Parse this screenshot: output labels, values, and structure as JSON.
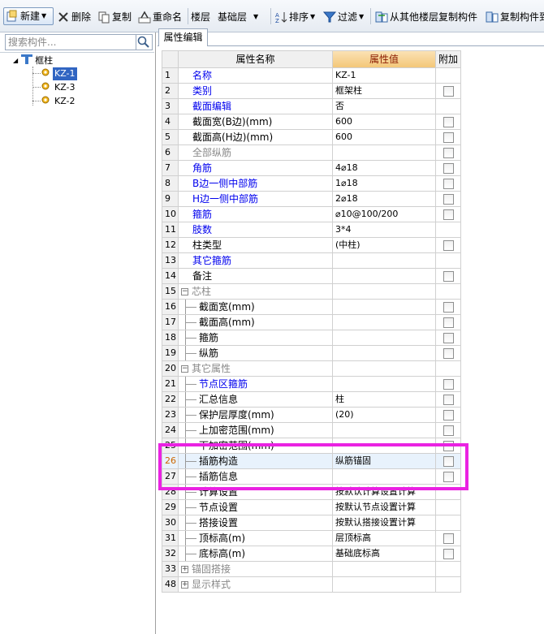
{
  "toolbar": {
    "new_label": "新建",
    "delete_label": "删除",
    "copy_label": "复制",
    "rename_label": "重命名",
    "floor_label": "楼层",
    "floor_value": "基础层",
    "sort_label": "排序",
    "filter_label": "过滤",
    "copy_from_floor_label": "从其他楼层复制构件",
    "copy_component_label": "复制构件到"
  },
  "left": {
    "search_placeholder": "搜索构件...",
    "tree": {
      "root": "框柱",
      "children": [
        "KZ-1",
        "KZ-3",
        "KZ-2"
      ]
    }
  },
  "tab": {
    "label": "属性编辑"
  },
  "table": {
    "headers": {
      "name": "属性名称",
      "value": "属性值",
      "add": "附加"
    },
    "rows": [
      {
        "num": "1",
        "name": "名称",
        "value": "KZ-1",
        "style": "blue",
        "indent": false,
        "check": false,
        "expander": ""
      },
      {
        "num": "2",
        "name": "类别",
        "value": "框架柱",
        "style": "blue",
        "indent": false,
        "check": true,
        "expander": ""
      },
      {
        "num": "3",
        "name": "截面编辑",
        "value": "否",
        "style": "blue",
        "indent": false,
        "check": false,
        "expander": ""
      },
      {
        "num": "4",
        "name": "截面宽(B边)(mm)",
        "value": "600",
        "style": "black",
        "indent": false,
        "check": true,
        "expander": ""
      },
      {
        "num": "5",
        "name": "截面高(H边)(mm)",
        "value": "600",
        "style": "black",
        "indent": false,
        "check": true,
        "expander": ""
      },
      {
        "num": "6",
        "name": "全部纵筋",
        "value": "",
        "style": "gray",
        "indent": false,
        "check": true,
        "expander": ""
      },
      {
        "num": "7",
        "name": "角筋",
        "value": "4⌀18",
        "style": "blue",
        "indent": false,
        "check": true,
        "expander": ""
      },
      {
        "num": "8",
        "name": "B边一侧中部筋",
        "value": "1⌀18",
        "style": "blue",
        "indent": false,
        "check": true,
        "expander": ""
      },
      {
        "num": "9",
        "name": "H边一侧中部筋",
        "value": "2⌀18",
        "style": "blue",
        "indent": false,
        "check": true,
        "expander": ""
      },
      {
        "num": "10",
        "name": "箍筋",
        "value": "⌀10@100/200",
        "style": "blue",
        "indent": false,
        "check": true,
        "expander": ""
      },
      {
        "num": "11",
        "name": "肢数",
        "value": "3*4",
        "style": "blue",
        "indent": false,
        "check": false,
        "expander": ""
      },
      {
        "num": "12",
        "name": "柱类型",
        "value": "(中柱)",
        "style": "black",
        "indent": false,
        "check": true,
        "expander": ""
      },
      {
        "num": "13",
        "name": "其它箍筋",
        "value": "",
        "style": "blue",
        "indent": false,
        "check": false,
        "expander": ""
      },
      {
        "num": "14",
        "name": "备注",
        "value": "",
        "style": "black",
        "indent": false,
        "check": true,
        "expander": ""
      },
      {
        "num": "15",
        "name": "芯柱",
        "value": "",
        "style": "gray",
        "indent": false,
        "check": false,
        "expander": "−"
      },
      {
        "num": "16",
        "name": "截面宽(mm)",
        "value": "",
        "style": "black",
        "indent": true,
        "check": true,
        "expander": ""
      },
      {
        "num": "17",
        "name": "截面高(mm)",
        "value": "",
        "style": "black",
        "indent": true,
        "check": true,
        "expander": ""
      },
      {
        "num": "18",
        "name": "箍筋",
        "value": "",
        "style": "black",
        "indent": true,
        "check": true,
        "expander": ""
      },
      {
        "num": "19",
        "name": "纵筋",
        "value": "",
        "style": "black",
        "indent": true,
        "check": true,
        "expander": ""
      },
      {
        "num": "20",
        "name": "其它属性",
        "value": "",
        "style": "gray",
        "indent": false,
        "check": false,
        "expander": "−"
      },
      {
        "num": "21",
        "name": "节点区箍筋",
        "value": "",
        "style": "blue",
        "indent": true,
        "check": true,
        "expander": ""
      },
      {
        "num": "22",
        "name": "汇总信息",
        "value": "柱",
        "style": "black",
        "indent": true,
        "check": true,
        "expander": ""
      },
      {
        "num": "23",
        "name": "保护层厚度(mm)",
        "value": "(20)",
        "style": "black",
        "indent": true,
        "check": true,
        "expander": ""
      },
      {
        "num": "24",
        "name": "上加密范围(mm)",
        "value": "",
        "style": "black",
        "indent": true,
        "check": true,
        "expander": ""
      },
      {
        "num": "25",
        "name": "下加密范围(mm)",
        "value": "",
        "style": "black",
        "indent": true,
        "check": true,
        "expander": ""
      },
      {
        "num": "26",
        "name": "插筋构造",
        "value": "纵筋锚固",
        "style": "black",
        "indent": true,
        "check": true,
        "expander": "",
        "selected": true
      },
      {
        "num": "27",
        "name": "插筋信息",
        "value": "",
        "style": "black",
        "indent": true,
        "check": true,
        "expander": ""
      },
      {
        "num": "28",
        "name": "计算设置",
        "value": "按默认计算设置计算",
        "style": "black",
        "indent": true,
        "check": false,
        "expander": ""
      },
      {
        "num": "29",
        "name": "节点设置",
        "value": "按默认节点设置计算",
        "style": "black",
        "indent": true,
        "check": false,
        "expander": ""
      },
      {
        "num": "30",
        "name": "搭接设置",
        "value": "按默认搭接设置计算",
        "style": "black",
        "indent": true,
        "check": false,
        "expander": ""
      },
      {
        "num": "31",
        "name": "顶标高(m)",
        "value": "层顶标高",
        "style": "black",
        "indent": true,
        "check": true,
        "expander": ""
      },
      {
        "num": "32",
        "name": "底标高(m)",
        "value": "基础底标高",
        "style": "black",
        "indent": true,
        "check": true,
        "expander": ""
      },
      {
        "num": "33",
        "name": "锚固搭接",
        "value": "",
        "style": "gray",
        "indent": false,
        "check": false,
        "expander": "+"
      },
      {
        "num": "48",
        "name": "显示样式",
        "value": "",
        "style": "gray",
        "indent": false,
        "check": false,
        "expander": "+"
      }
    ]
  },
  "colors": {
    "highlight": "#ea22e2",
    "header_value_bg": "#f3c778",
    "selected_tree": "#3165c2",
    "blue_text": "#0000ee"
  }
}
